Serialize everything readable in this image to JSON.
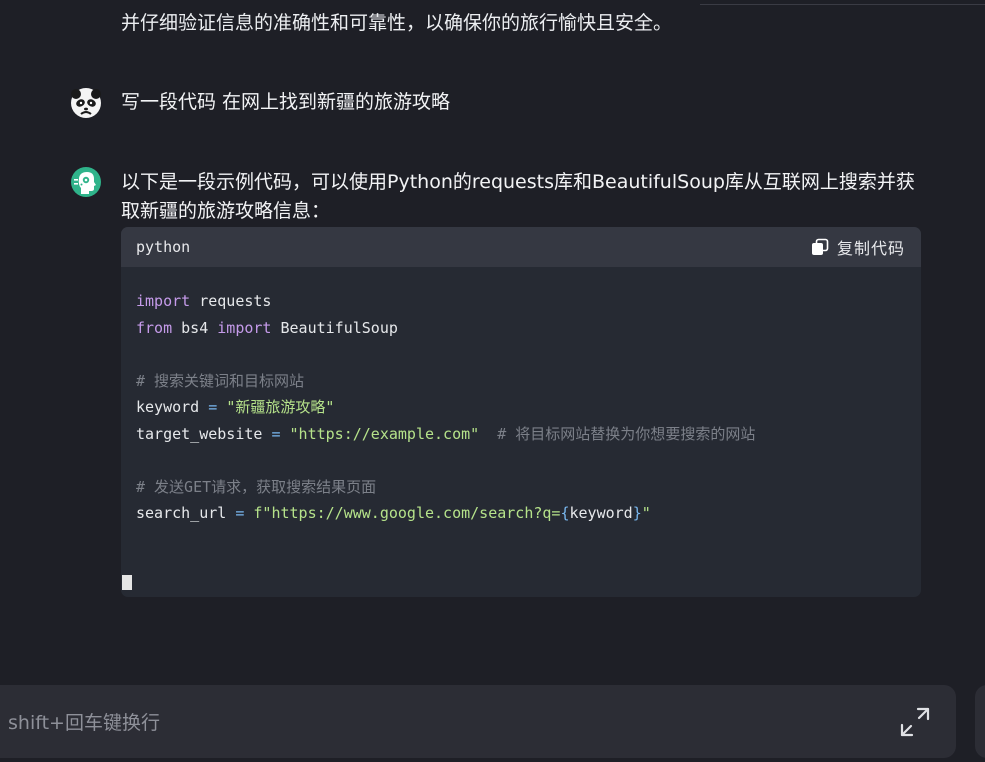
{
  "conversation": {
    "previous_text": "并仔细验证信息的准确性和可靠性，以确保你的旅行愉快且安全。",
    "user_message": "写一段代码 在网上找到新疆的旅游攻略",
    "bot_message": "以下是一段示例代码，可以使用Python的requests库和BeautifulSoup库从互联网上搜索并获取新疆的旅游攻略信息：",
    "code_block": {
      "language": "python",
      "copy_label": "复制代码",
      "lines": [
        "import requests",
        "from bs4 import BeautifulSoup",
        "",
        "# 搜索关键词和目标网站",
        "keyword = \"新疆旅游攻略\"",
        "target_website = \"https://example.com\"  # 将目标网站替换为你想要搜索的网站",
        "",
        "# 发送GET请求，获取搜索结果页面",
        "search_url = f\"https://www.google.com/search?q={keyword}\""
      ]
    }
  },
  "input": {
    "placeholder": "shift+回车键换行"
  },
  "icons": {
    "user_avatar": "panda-avatar-icon",
    "bot_avatar": "robot-avatar-icon",
    "copy": "copy-icon",
    "expand": "expand-icon"
  },
  "colors": {
    "background": "#1e1f26",
    "code_background": "#262a33",
    "code_header": "#353842",
    "input_background": "#2c2d35",
    "keyword": "#c59bea",
    "string": "#b5e28a",
    "comment": "#7c8089",
    "bot_avatar": "#2fb38a"
  }
}
